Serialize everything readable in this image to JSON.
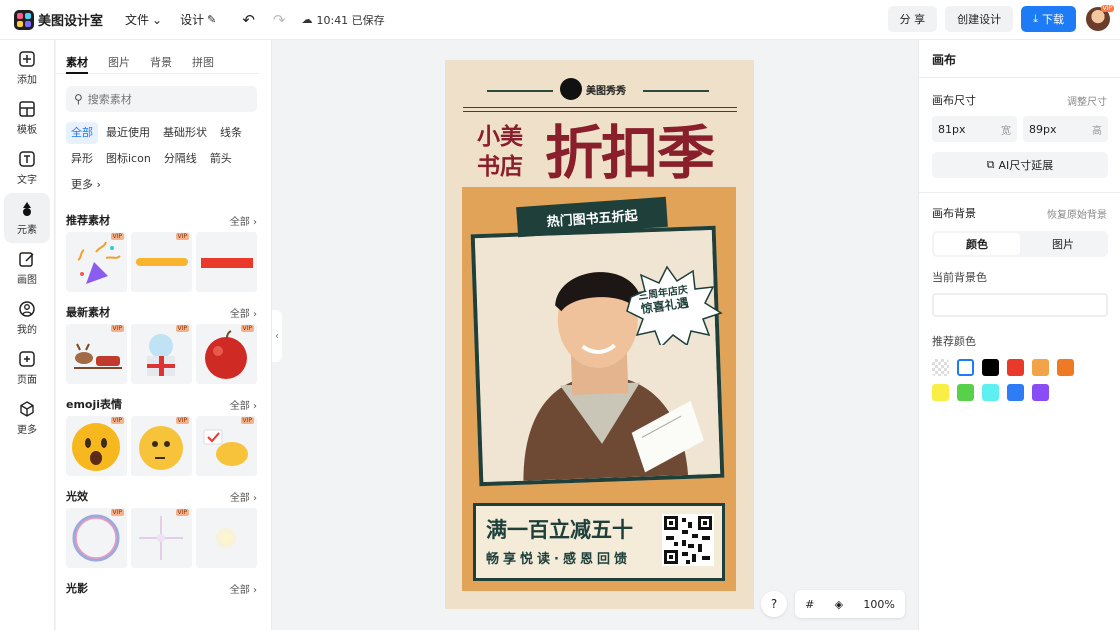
{
  "app": {
    "name": "美图设计室"
  },
  "menu": {
    "file": "文件",
    "design": "设计"
  },
  "save_status": "10:41 已保存",
  "toolbar": {
    "share": "分 享",
    "create": "创建设计",
    "download": "下载",
    "avatar_vip": "VIP"
  },
  "rail": [
    {
      "label": "添加",
      "icon": "plus-square-icon"
    },
    {
      "label": "模板",
      "icon": "template-icon"
    },
    {
      "label": "文字",
      "icon": "text-icon"
    },
    {
      "label": "元素",
      "icon": "shapes-icon"
    },
    {
      "label": "画图",
      "icon": "pen-edit-icon"
    },
    {
      "label": "我的",
      "icon": "user-icon"
    },
    {
      "label": "页面",
      "icon": "page-add-icon"
    },
    {
      "label": "更多",
      "icon": "cube-icon"
    }
  ],
  "panel": {
    "tabs": [
      "素材",
      "图片",
      "背景",
      "拼图"
    ],
    "search_placeholder": "搜索素材",
    "chips": [
      "全部",
      "最近使用",
      "基础形状",
      "线条",
      "异形",
      "图标icon",
      "分隔线",
      "箭头",
      "更多"
    ],
    "all_label": "全部",
    "vip": "VIP",
    "sections": [
      "推荐素材",
      "最新素材",
      "emoji表情",
      "光效",
      "光影"
    ]
  },
  "poster": {
    "brand": "美图秀秀",
    "small_title": "小美书店",
    "big_title": "折扣季",
    "ribbon": "热门图书五折起",
    "burst_1": "三周年店庆",
    "burst_2": "惊喜礼遇",
    "promo_1": "满一百立减五十",
    "promo_2": "畅享悦读·感恩回馈"
  },
  "float": {
    "help": "?",
    "zoom": "100%"
  },
  "right": {
    "title": "画布",
    "size_label": "画布尺寸",
    "size_adjust": "调整尺寸",
    "width_value": "81px",
    "width_unit": "宽",
    "height_value": "89px",
    "height_unit": "高",
    "ai_extend": "AI尺寸延展",
    "bg_label": "画布背景",
    "bg_reset": "恢复原始背景",
    "seg_color": "颜色",
    "seg_image": "图片",
    "current_bg": "当前背景色",
    "recommended": "推荐颜色",
    "swatches": [
      "transparent",
      "#ffffff",
      "#000000",
      "#e8392b",
      "#f3a34a",
      "#ef7a26",
      "#f9ee45",
      "#57d14a",
      "#5ef0ee",
      "#2f7df6",
      "#8a4df5"
    ]
  }
}
